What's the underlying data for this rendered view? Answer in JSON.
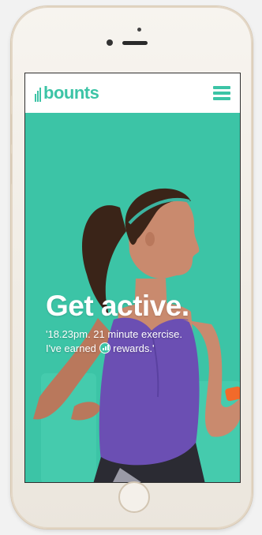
{
  "app": {
    "logo_text": "bounts",
    "logo_icon": "bar-chart-icon",
    "menu_icon": "hamburger-menu-icon"
  },
  "hero": {
    "headline": "Get active.",
    "quote_line1": "'18.23pm. 21 minute exercise.",
    "quote_line2_prefix": "I've earned",
    "quote_line2_icon": "bounts-reward-icon",
    "quote_line2_suffix": "rewards.'",
    "scroll_icon": "chevron-down-icon"
  },
  "colors": {
    "brand": "#3cc4a6",
    "header_bg": "#ffffff",
    "tank_top": "#6b4fb3",
    "skin": "#c98a6e",
    "hair": "#3a2418",
    "wristband": "#f26a2a"
  }
}
